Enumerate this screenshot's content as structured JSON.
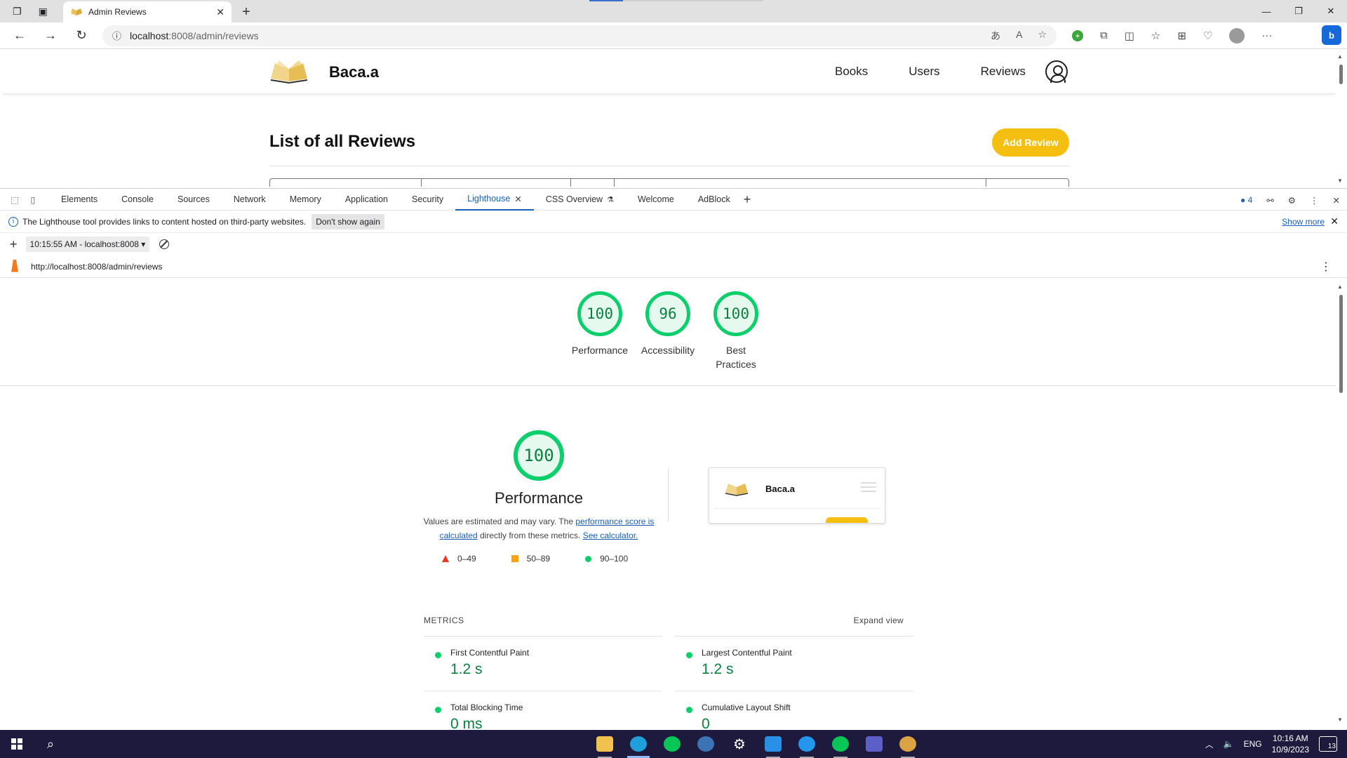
{
  "browser": {
    "tab_title": "Admin Reviews",
    "url_host": "localhost",
    "url_path": ":8008/admin/reviews"
  },
  "site": {
    "brand": "Baca.a",
    "nav": [
      "Books",
      "Users",
      "Reviews"
    ],
    "page_title": "List of all Reviews",
    "add_review_label": "Add Review",
    "accent_color": "#f5bf12"
  },
  "devtools": {
    "tabs": [
      "Elements",
      "Console",
      "Sources",
      "Network",
      "Memory",
      "Application",
      "Security",
      "Lighthouse",
      "CSS Overview",
      "Welcome",
      "AdBlock"
    ],
    "active_tab": "Lighthouse",
    "issues_count": "4",
    "info_message": "The Lighthouse tool provides links to content hosted on third-party websites.",
    "dont_show_again": "Don't show again",
    "show_more": "Show more",
    "report_selector": "10:15:55 AM - localhost:8008",
    "report_url": "http://localhost:8008/admin/reviews"
  },
  "lighthouse": {
    "scores": [
      {
        "label": "Performance",
        "value": "100"
      },
      {
        "label": "Accessibility",
        "value": "96"
      },
      {
        "label": "Best Practices",
        "value": "100"
      }
    ],
    "perf_score": "100",
    "perf_title": "Performance",
    "desc_prefix": "Values are estimated and may vary. The ",
    "desc_link1": "performance score is calculated",
    "desc_middle": " directly from these metrics. ",
    "desc_link2": "See calculator.",
    "legend": [
      "0–49",
      "50–89",
      "90–100"
    ],
    "thumb_brand": "Baca.a",
    "metrics_heading": "METRICS",
    "expand_view": "Expand view",
    "metrics": [
      {
        "name": "First Contentful Paint",
        "value": "1.2 s"
      },
      {
        "name": "Largest Contentful Paint",
        "value": "1.2 s"
      },
      {
        "name": "Total Blocking Time",
        "value": "0 ms"
      },
      {
        "name": "Cumulative Layout Shift",
        "value": "0"
      }
    ],
    "good_color": "#0cce6b"
  },
  "taskbar": {
    "lang": "ENG",
    "time": "10:16 AM",
    "date": "10/9/2023",
    "notifications": "13"
  }
}
